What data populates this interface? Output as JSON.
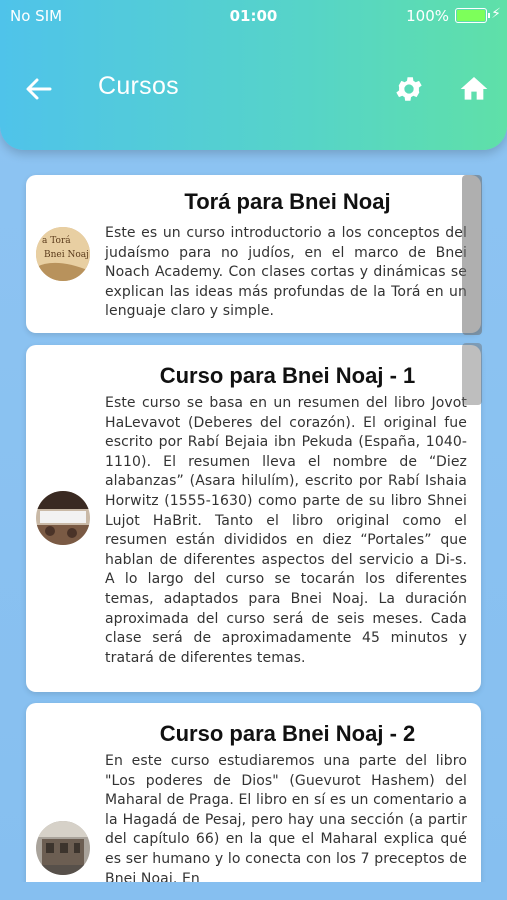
{
  "status_bar": {
    "carrier": "No SIM",
    "time": "01:00",
    "battery": "100%",
    "battery_level": 1.0
  },
  "appbar": {
    "title": "Cursos",
    "back_icon": "arrow-left-icon",
    "settings_icon": "gear-icon",
    "home_icon": "home-icon"
  },
  "courses": [
    {
      "title": "Torá para Bnei Noaj",
      "thumbnail_text": "a Torá\nBnei Noaj",
      "description": "Este es un curso introductorio a los conceptos del judaísmo para no judíos, en el marco de Bnei Noach Academy. Con clases cortas y dinámicas se explican las ideas más profundas de la Torá en un lenguaje claro y simple."
    },
    {
      "title": "Curso para Bnei Noaj - 1",
      "description": "Este curso se basa en un resumen del libro Jovot HaLevavot (Deberes del corazón). El original fue escrito por Rabí Bejaia ibn Pekuda (España, 1040-1110). El resumen lleva el nombre de “Diez alabanzas” (Asara hilulím), escrito por Rabí Ishaia Horwitz (1555-1630) como parte de su libro Shnei Lujot HaBrit. Tanto el libro original como el resumen están divididos en diez “Portales” que hablan de diferentes aspectos del servicio a Di-s. A lo largo del curso se tocarán los diferentes temas, adaptados para Bnei Noaj. La duración aproximada del curso será de seis meses. Cada clase será de aproximadamente 45 minutos y tratará de diferentes temas."
    },
    {
      "title": "Curso para Bnei Noaj - 2",
      "description": "En este curso estudiaremos una parte del libro \"Los poderes de Dios\" (Guevurot Hashem) del Maharal de Praga. El libro en sí es un comentario a la Hagadá de Pesaj, pero hay una sección (a partir del capítulo 66) en la que el Maharal explica qué es ser humano y lo conecta con los 7 preceptos de Bnei Noaj. En"
    }
  ]
}
